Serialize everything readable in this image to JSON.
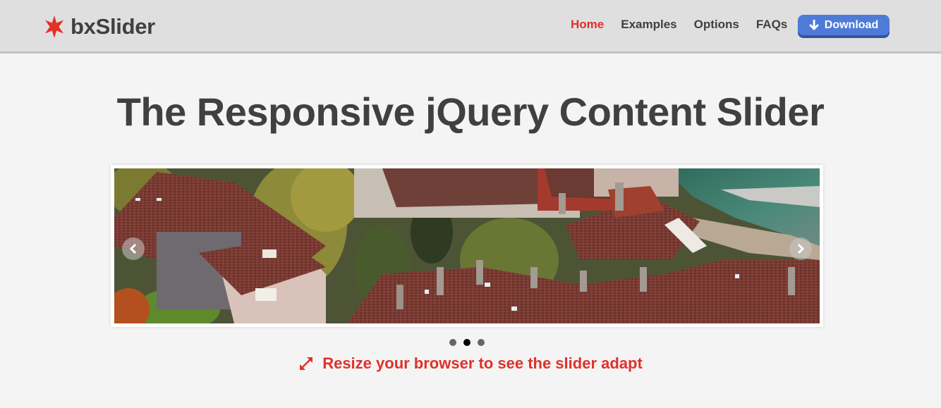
{
  "header": {
    "logo_text": "bxSlider",
    "logo_icon": "star-icon",
    "nav": [
      {
        "label": "Home",
        "active": true
      },
      {
        "label": "Examples",
        "active": false
      },
      {
        "label": "Options",
        "active": false
      },
      {
        "label": "FAQs",
        "active": false
      }
    ],
    "download_label": "Download",
    "download_icon": "arrow-down-icon"
  },
  "main": {
    "title": "The Responsive jQuery Content Slider",
    "slider": {
      "image_alt": "Aerial view of red-tiled rooftops of old town houses beside a river",
      "prev_icon": "chevron-left-icon",
      "next_icon": "chevron-right-icon",
      "total_slides": 3,
      "active_slide": 2
    },
    "caption": "Resize your browser to see the slider adapt",
    "caption_icon": "resize-arrows-icon"
  },
  "colors": {
    "accent_red": "#e0312a",
    "download_blue": "#4f7bd8",
    "header_bg": "#dfdfdf",
    "page_bg": "#f4f4f4",
    "text_dark": "#404040"
  }
}
